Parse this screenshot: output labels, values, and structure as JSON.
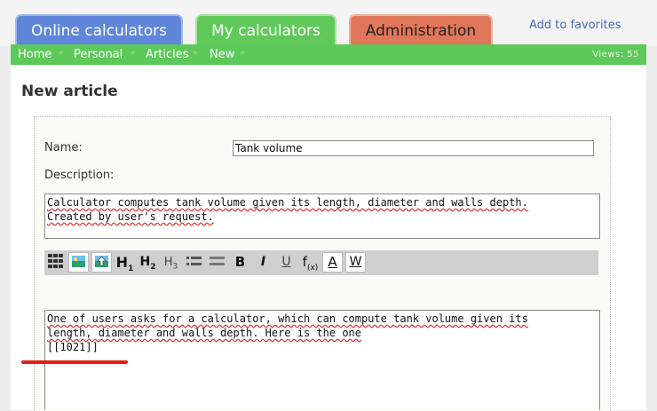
{
  "tabs": {
    "online": "Online calculators",
    "my": "My calculators",
    "admin": "Administration"
  },
  "favorites": "Add to favorites",
  "nav": {
    "items": [
      "Home",
      "Personal",
      "Articles",
      "New"
    ],
    "separator": "»",
    "views": "Views: 55"
  },
  "page_title": "New article",
  "form": {
    "name_label": "Name:",
    "name_value": "Tank volume",
    "description_label": "Description:",
    "description_lines": [
      "Calculator computes tank volume given its length, diameter and walls depth.",
      "Created by user's request."
    ],
    "body_lines": [
      "One of users asks for a calculator, which can compute tank volume given its",
      "length, diameter and walls depth. Here is the one",
      "[[1021]]"
    ]
  },
  "toolbar": {
    "h1": "H",
    "h1_sub": "1",
    "h2": "H",
    "h2_sub": "2",
    "h3": "H",
    "h3_sub": "3",
    "bold": "B",
    "italic": "I",
    "underline": "U",
    "formula": "f",
    "formula_sub": "(x)",
    "a_button": "A",
    "w_button": "W"
  },
  "colors": {
    "tab_online": "#5f86d9",
    "tab_my": "#60c95a",
    "tab_admin": "#e0775a",
    "navbar": "#5cc95a",
    "annotation_line": "#e0211b"
  }
}
